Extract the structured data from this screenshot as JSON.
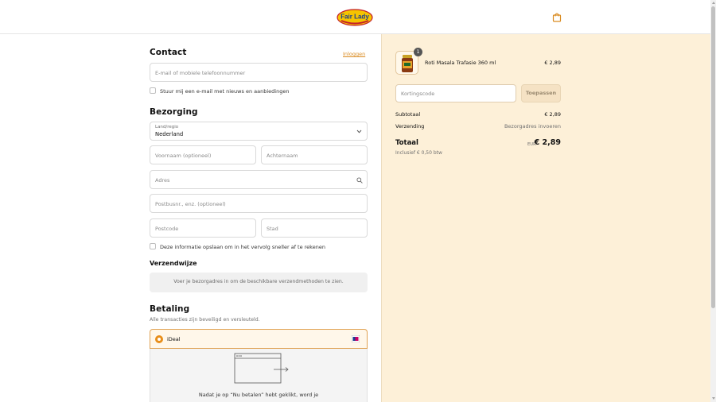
{
  "brand": {
    "logo_text": "Fair Lady"
  },
  "contact": {
    "title": "Contact",
    "login_link": "Inloggen",
    "email_placeholder": "E-mail of mobiele telefoonnummer",
    "newsletter_label": "Stuur mij een e-mail met nieuws en aanbiedingen"
  },
  "delivery": {
    "title": "Bezorging",
    "country_label": "Land/regio",
    "country_value": "Nederland",
    "first_name_placeholder": "Voornaam (optioneel)",
    "last_name_placeholder": "Achternaam",
    "address_placeholder": "Adres",
    "address2_placeholder": "Postbusnr., enz. (optioneel)",
    "postcode_placeholder": "Postcode",
    "city_placeholder": "Stad",
    "save_info_label": "Deze informatie opslaan om in het vervolg sneller af te rekenen"
  },
  "shipping_method": {
    "title": "Verzendwijze",
    "notice": "Voer je bezorgadres in om de beschikbare verzendmethoden te zien."
  },
  "payment": {
    "title": "Betaling",
    "subtitle": "Alle transacties zijn beveiligd en versleuteld.",
    "method_label": "iDeal",
    "redirect_note": "Nadat je op “Nu betalen” hebt geklikt, word je"
  },
  "summary": {
    "item": {
      "name": "Roti Masala Trafasie 360 ml",
      "price": "€ 2,89",
      "quantity": "1"
    },
    "discount_placeholder": "Kortingscode",
    "apply_label": "Toepassen",
    "subtotal_label": "Subtotaal",
    "subtotal_value": "€ 2,89",
    "shipping_label": "Verzending",
    "shipping_value": "Bezorgadres invoeren",
    "total_label": "Totaal",
    "currency": "EUR",
    "total_value": "€ 2,89",
    "vat_note": "Inclusief € 0,50 btw"
  },
  "colors": {
    "accent": "#e88e1a",
    "panel": "#fdf0d8"
  }
}
